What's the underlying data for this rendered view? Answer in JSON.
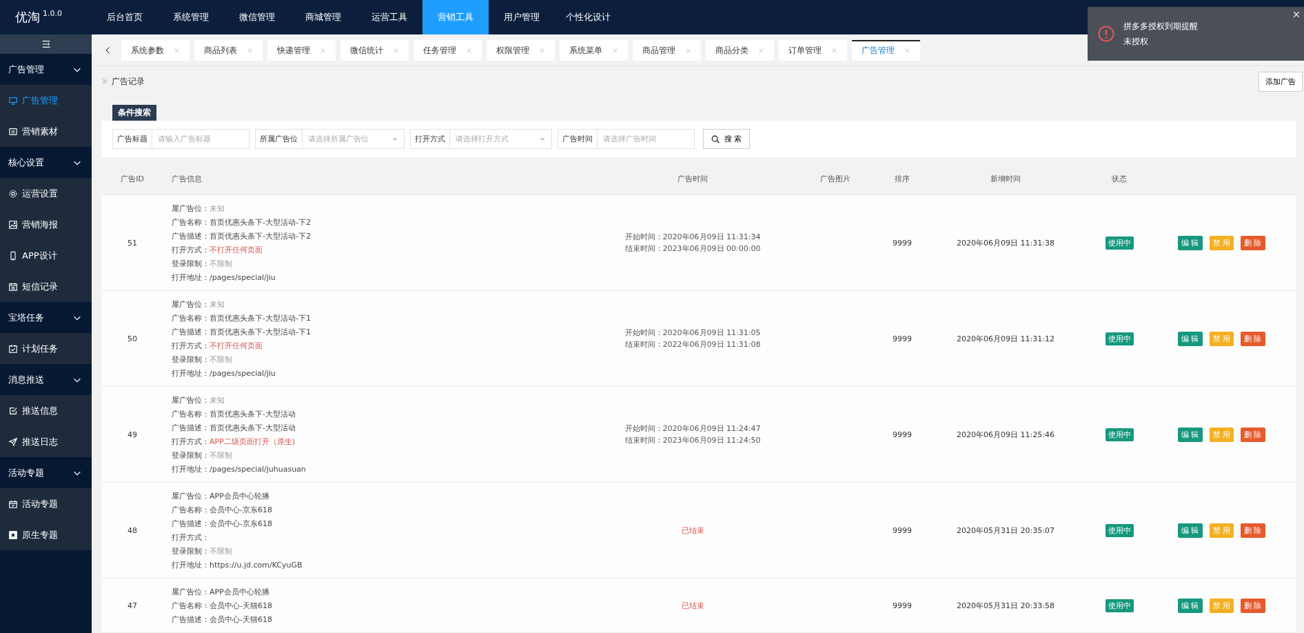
{
  "app": {
    "name": "优淘",
    "version": "1.0.0"
  },
  "top_nav": [
    {
      "label": "后台首页",
      "selected": false
    },
    {
      "label": "系统管理",
      "selected": false
    },
    {
      "label": "微信管理",
      "selected": false
    },
    {
      "label": "商城管理",
      "selected": false
    },
    {
      "label": "运营工具",
      "selected": false
    },
    {
      "label": "营销工具",
      "selected": true
    },
    {
      "label": "用户管理",
      "selected": false
    },
    {
      "label": "个性化设计",
      "selected": false
    }
  ],
  "sidebar": {
    "groups": [
      {
        "label": "广告管理",
        "expanded": true,
        "items": [
          {
            "label": "广告管理",
            "selected": true
          },
          {
            "label": "营销素材",
            "selected": false
          }
        ]
      },
      {
        "label": "核心设置",
        "expanded": true,
        "items": [
          {
            "label": "运营设置",
            "selected": false
          },
          {
            "label": "营销海报",
            "selected": false
          },
          {
            "label": "APP设计",
            "selected": false
          },
          {
            "label": "短信记录",
            "selected": false
          }
        ]
      },
      {
        "label": "宝塔任务",
        "expanded": true,
        "items": [
          {
            "label": "计划任务",
            "selected": false
          }
        ]
      },
      {
        "label": "消息推送",
        "expanded": true,
        "items": [
          {
            "label": "推送信息",
            "selected": false
          },
          {
            "label": "推送日志",
            "selected": false
          }
        ]
      },
      {
        "label": "活动专题",
        "expanded": true,
        "items": [
          {
            "label": "活动专题",
            "selected": false
          },
          {
            "label": "原生专题",
            "selected": false
          }
        ]
      }
    ]
  },
  "tabs": [
    {
      "label": "系统参数",
      "selected": false
    },
    {
      "label": "商品列表",
      "selected": false
    },
    {
      "label": "快递管理",
      "selected": false
    },
    {
      "label": "微信统计",
      "selected": false
    },
    {
      "label": "任务管理",
      "selected": false
    },
    {
      "label": "权限管理",
      "selected": false
    },
    {
      "label": "系统菜单",
      "selected": false
    },
    {
      "label": "商品管理",
      "selected": false
    },
    {
      "label": "商品分类",
      "selected": false
    },
    {
      "label": "订单管理",
      "selected": false
    },
    {
      "label": "广告管理",
      "selected": true
    }
  ],
  "breadcrumb": "广告记录",
  "add_button": "添加广告",
  "search": {
    "title": "条件搜索",
    "fields": [
      {
        "kind": "text",
        "label": "广告标题",
        "placeholder": "请输入广告标题"
      },
      {
        "kind": "select",
        "label": "所属广告位",
        "placeholder": "请选择所属广告位"
      },
      {
        "kind": "select",
        "label": "打开方式",
        "placeholder": "请选择打开方式"
      },
      {
        "kind": "text",
        "label": "广告时间",
        "placeholder": "请选择广告时间"
      }
    ],
    "button": "搜 索"
  },
  "table": {
    "columns": [
      "广告ID",
      "广告信息",
      "广告时间",
      "广告图片",
      "排序",
      "新增时间",
      "状态"
    ],
    "rows": [
      {
        "id": "51",
        "info": [
          {
            "label": "屋广告位：",
            "value": "未知",
            "greyed": true,
            "warning": false
          },
          {
            "label": "广告名称：",
            "value": "首页优惠头条下-大型活动-下2",
            "greyed": false,
            "warning": false
          },
          {
            "label": "广告描述：",
            "value": "首页优惠头条下-大型活动-下2",
            "greyed": false,
            "warning": false
          },
          {
            "label": "打开方式：",
            "value": "不打开任何页面",
            "greyed": false,
            "warning": true
          },
          {
            "label": "登录限制：",
            "value": "不限制",
            "greyed": true,
            "warning": false
          },
          {
            "label": "打开地址：",
            "value": "/pages/special/jiu",
            "greyed": false,
            "warning": false
          }
        ],
        "time": {
          "kind": "range",
          "lines": [
            "开始时间：2020年06月09日 11:31:34",
            "结束时间：2023年06月09日 00:00:00"
          ]
        },
        "sort": "9999",
        "created": "2020年06月09日 11:31:38",
        "status": "使用中",
        "actions": [
          {
            "kind": "edit",
            "label": "编 辑"
          },
          {
            "kind": "disable",
            "label": "禁 用"
          },
          {
            "kind": "delete",
            "label": "删 除"
          }
        ]
      },
      {
        "id": "50",
        "info": [
          {
            "label": "屋广告位：",
            "value": "未知",
            "greyed": true,
            "warning": false
          },
          {
            "label": "广告名称：",
            "value": "首页优惠头条下-大型活动-下1",
            "greyed": false,
            "warning": false
          },
          {
            "label": "广告描述：",
            "value": "首页优惠头条下-大型活动-下1",
            "greyed": false,
            "warning": false
          },
          {
            "label": "打开方式：",
            "value": "不打开任何页面",
            "greyed": false,
            "warning": true
          },
          {
            "label": "登录限制：",
            "value": "不限制",
            "greyed": true,
            "warning": false
          },
          {
            "label": "打开地址：",
            "value": "/pages/special/jiu",
            "greyed": false,
            "warning": false
          }
        ],
        "time": {
          "kind": "range",
          "lines": [
            "开始时间：2020年06月09日 11:31:05",
            "结束时间：2022年06月09日 11:31:08"
          ]
        },
        "sort": "9999",
        "created": "2020年06月09日 11:31:12",
        "status": "使用中",
        "actions": [
          {
            "kind": "edit",
            "label": "编 辑"
          },
          {
            "kind": "disable",
            "label": "禁 用"
          },
          {
            "kind": "delete",
            "label": "删 除"
          }
        ]
      },
      {
        "id": "49",
        "info": [
          {
            "label": "屋广告位：",
            "value": "未知",
            "greyed": true,
            "warning": false
          },
          {
            "label": "广告名称：",
            "value": "首页优惠头条下-大型活动",
            "greyed": false,
            "warning": false
          },
          {
            "label": "广告描述：",
            "value": "首页优惠头条下-大型活动",
            "greyed": false,
            "warning": false
          },
          {
            "label": "打开方式：",
            "value": "APP二级页面打开（原生)",
            "greyed": false,
            "warning": true
          },
          {
            "label": "登录限制：",
            "value": "不限制",
            "greyed": true,
            "warning": false
          },
          {
            "label": "打开地址：",
            "value": "/pages/special/juhuasuan",
            "greyed": false,
            "warning": false
          }
        ],
        "time": {
          "kind": "range",
          "lines": [
            "开始时间：2020年06月09日 11:24:47",
            "结束时间：2023年06月09日 11:24:50"
          ]
        },
        "sort": "9999",
        "created": "2020年06月09日 11:25:46",
        "status": "使用中",
        "actions": [
          {
            "kind": "edit",
            "label": "编 辑"
          },
          {
            "kind": "disable",
            "label": "禁 用"
          },
          {
            "kind": "delete",
            "label": "删 除"
          }
        ]
      },
      {
        "id": "48",
        "info": [
          {
            "label": "屋广告位：",
            "value": "APP会员中心轮播",
            "greyed": false,
            "warning": false
          },
          {
            "label": "广告名称：",
            "value": "会员中心-京东618",
            "greyed": false,
            "warning": false
          },
          {
            "label": "广告描述：",
            "value": "会员中心-京东618",
            "greyed": false,
            "warning": false
          },
          {
            "label": "打开方式："
          },
          {
            "label": "登录限制：",
            "value": "不限制",
            "greyed": true,
            "warning": false
          },
          {
            "label": "打开地址：",
            "value": "https://u.jd.com/KCyuGB",
            "greyed": false,
            "warning": false
          }
        ],
        "time": {
          "kind": "ended",
          "text": "已结束"
        },
        "sort": "9999",
        "created": "2020年05月31日 20:35:07",
        "status": "使用中",
        "actions": [
          {
            "kind": "edit",
            "label": "编 辑"
          },
          {
            "kind": "disable",
            "label": "禁 用"
          },
          {
            "kind": "delete",
            "label": "删 除"
          }
        ]
      },
      {
        "id": "47",
        "info": [
          {
            "label": "屋广告位：",
            "value": "APP会员中心轮播",
            "greyed": false,
            "warning": false
          },
          {
            "label": "广告名称：",
            "value": "会员中心-天猫618",
            "greyed": false,
            "warning": false
          },
          {
            "label": "广告描述：",
            "value": "会员中心-天猫618",
            "greyed": false,
            "warning": false
          }
        ],
        "time": {
          "kind": "ended",
          "text": "已结束"
        },
        "sort": "9999",
        "created": "2020年05月31日 20:33:58",
        "status": "使用中",
        "actions": [
          {
            "kind": "edit",
            "label": "编 辑"
          },
          {
            "kind": "disable",
            "label": "禁 用"
          },
          {
            "kind": "delete",
            "label": "删 除"
          }
        ]
      }
    ]
  },
  "notification": {
    "title": "拼多多授权到期提醒",
    "message": "未授权"
  }
}
